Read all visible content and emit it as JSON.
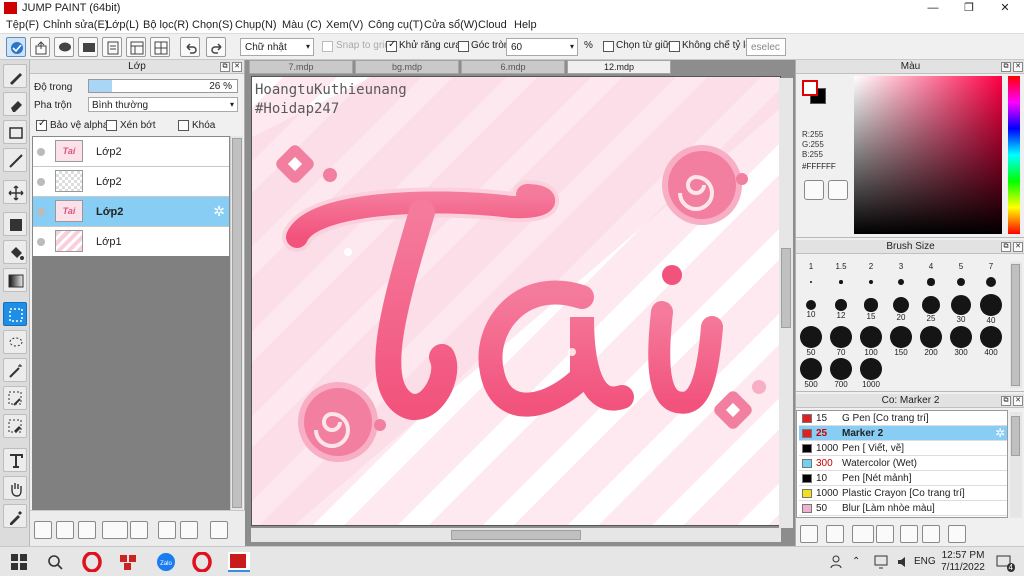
{
  "window": {
    "title": "JUMP PAINT (64bit)",
    "min": "—",
    "max": "❐",
    "close": "✕"
  },
  "menu": [
    "Tệp(F)",
    "Chỉnh sửa(E)",
    "Lớp(L)",
    "Bộ lọc(R)",
    "Chọn(S)",
    "Chụp(N)",
    "Màu (C)",
    "Xem(V)",
    "Công cụ(T)",
    "Cửa sổ(W)",
    "Cloud",
    "Help"
  ],
  "toolbar": {
    "shape": "Chữ nhật",
    "snap_label": "Snap to grid",
    "antialias_label": "Khử răng cưa",
    "rounded_label": "Góc tròn",
    "rounded_value": "60",
    "percent": "%",
    "center_label": "Chọn từ giữa",
    "noaspect_label": "Không chế tỷ lệ",
    "deselect": "eselec"
  },
  "layers": {
    "title": "Lớp",
    "opacity_label": "Độ trong",
    "opacity_value": "26 %",
    "opacity_fraction": 0.26,
    "blend_label": "Pha trộn",
    "blend_value": "Bình thường",
    "protect_alpha": "Bảo vệ alpha",
    "clip_label": "Xén bớt",
    "lock_label": "Khóa",
    "items": [
      {
        "name": "Lớp2",
        "thumb": "Tai"
      },
      {
        "name": "Lớp2",
        "thumb": ""
      },
      {
        "name": "Lớp2",
        "thumb": "Tai"
      },
      {
        "name": "Lớp1",
        "thumb": ""
      }
    ]
  },
  "tabs": [
    "7.mdp",
    "bg.mdp",
    "6.mdp",
    "12.mdp"
  ],
  "canvas": {
    "watermark_line1": "HoangtuKuthieunang",
    "watermark_line2": "#Hoidap247",
    "art_text": "Tai"
  },
  "color": {
    "title": "Màu",
    "r": "R:255",
    "g": "G:255",
    "b": "B:255",
    "hex": "#FFFFFF"
  },
  "brushsize": {
    "title": "Brush Size",
    "sizes": [
      "1",
      "1.5",
      "2",
      "3",
      "4",
      "5",
      "7",
      "10",
      "12",
      "15",
      "20",
      "25",
      "30",
      "40",
      "50",
      "70",
      "100",
      "150",
      "200",
      "300",
      "400",
      "500",
      "700",
      "1000"
    ]
  },
  "brushes": {
    "title": "Co: Marker 2",
    "items": [
      {
        "size": "15",
        "name": "G Pen [Co trang trí]",
        "color": "#e02020"
      },
      {
        "size": "25",
        "name": "Marker 2",
        "color": "#e02020"
      },
      {
        "size": "1000",
        "name": "Pen [ Viết, vẽ]",
        "color": "#000000"
      },
      {
        "size": "300",
        "name": "Watercolor (Wet)",
        "color": "#6fd2f0"
      },
      {
        "size": "10",
        "name": "Pen [Nét mảnh]",
        "color": "#000000"
      },
      {
        "size": "1000",
        "name": "Plastic Crayon [Co trang trí]",
        "color": "#f0e020"
      },
      {
        "size": "50",
        "name": "Blur [Làm nhòe màu]",
        "color": "#f0b0d0"
      }
    ]
  },
  "statusbar": {
    "time": "12:57 PM",
    "date": "7/11/2022",
    "lang": "ENG",
    "notif": "4"
  },
  "colors": {
    "accent": "#1f8ee6",
    "selected_row": "#87cdf4",
    "pink": "#f06a8e",
    "pink_light": "#f9d3df"
  }
}
